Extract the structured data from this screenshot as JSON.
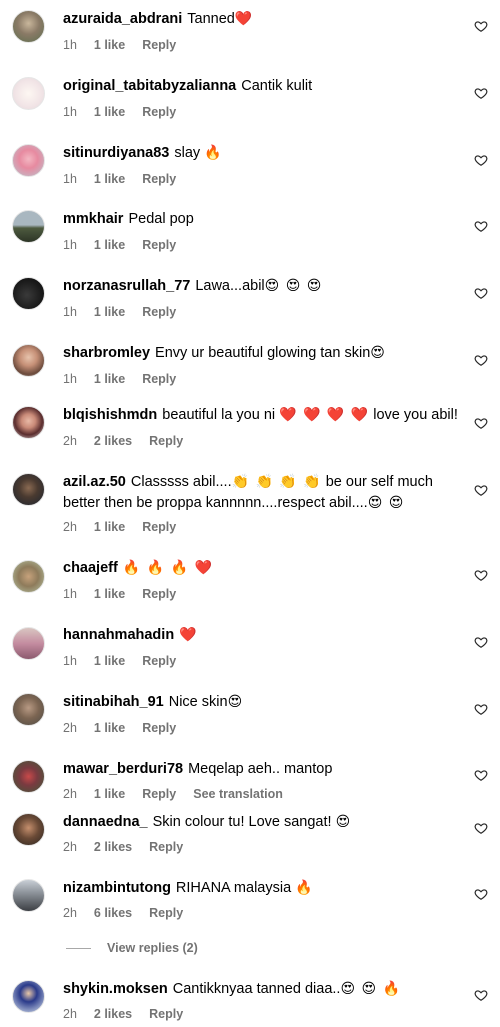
{
  "icons": {
    "like": "heart-outline-icon"
  },
  "colors": {
    "meta_gray": "#737373",
    "red_heart": "#ff3040"
  },
  "comments": [
    {
      "username": "azuraida_abdrani",
      "text": "Tanned",
      "emoji": "❤️",
      "time": "1h",
      "likes": "1 like",
      "reply": "Reply"
    },
    {
      "username": "original_tabitabyzalianna",
      "text": "Cantik kulit",
      "emoji": "",
      "time": "1h",
      "likes": "1 like",
      "reply": "Reply"
    },
    {
      "username": "sitinurdiyana83",
      "text": "slay",
      "emoji": "🔥",
      "time": "1h",
      "likes": "1 like",
      "reply": "Reply"
    },
    {
      "username": "mmkhair",
      "text": "Pedal pop",
      "emoji": "",
      "time": "1h",
      "likes": "1 like",
      "reply": "Reply"
    },
    {
      "username": "norzanasrullah_77",
      "text": "Lawa...abil",
      "emoji": "😍 😍 😍",
      "time": "1h",
      "likes": "1 like",
      "reply": "Reply"
    },
    {
      "username": "sharbromley",
      "text": "Envy ur beautiful glowing tan skin",
      "emoji": "😍",
      "time": "1h",
      "likes": "1 like",
      "reply": "Reply"
    },
    {
      "username": "blqishishmdn",
      "text": "beautiful la you ni",
      "emoji": "❤️ ❤️ ❤️ ❤️",
      "text2": "love you abil!",
      "time": "2h",
      "likes": "2 likes",
      "reply": "Reply"
    },
    {
      "username": "azil.az.50",
      "text": "Classsss abil....",
      "emoji": "👏 👏 👏 👏",
      "text2": "be our self much better then be proppa kannnnn....respect abil....",
      "emoji2": "😍 😍",
      "time": "2h",
      "likes": "1 like",
      "reply": "Reply"
    },
    {
      "username": "chaajeff",
      "text": "",
      "emoji": "🔥 🔥 🔥 ❤️",
      "time": "1h",
      "likes": "1 like",
      "reply": "Reply"
    },
    {
      "username": "hannahmahadin",
      "text": "",
      "emoji": "❤️",
      "time": "1h",
      "likes": "1 like",
      "reply": "Reply"
    },
    {
      "username": "sitinabihah_91",
      "text": "Nice skin",
      "emoji": "😍",
      "time": "2h",
      "likes": "1 like",
      "reply": "Reply"
    },
    {
      "username": "mawar_berduri78",
      "text": "Meqelap aeh.. mantop",
      "emoji": "",
      "time": "2h",
      "likes": "1 like",
      "reply": "Reply",
      "translate": "See translation"
    },
    {
      "username": "dannaedna_",
      "text": "Skin colour tu! Love sangat!",
      "emoji": "😍",
      "time": "2h",
      "likes": "2 likes",
      "reply": "Reply"
    },
    {
      "username": "nizambintutong",
      "text": "RIHANA malaysia",
      "emoji": "🔥",
      "time": "2h",
      "likes": "6 likes",
      "reply": "Reply",
      "view_replies": "View replies (2)"
    },
    {
      "username": "shykin.moksen",
      "text": "Cantikknyaa tanned diaa..",
      "emoji": "😍 😍 🔥",
      "time": "2h",
      "likes": "2 likes",
      "reply": "Reply"
    }
  ]
}
